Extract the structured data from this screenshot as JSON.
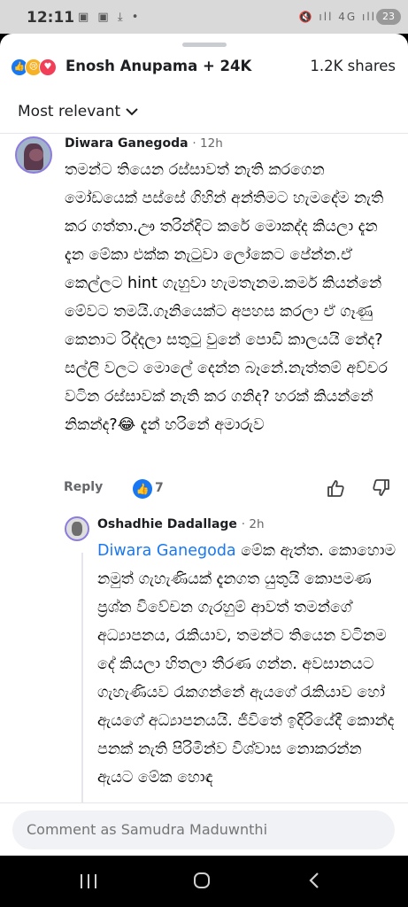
{
  "status_bar": {
    "time": "12:11",
    "left_icons": "▣ ▣ ⤓ •",
    "right_icons": "🔇 ıll 4G ıll",
    "battery": "23"
  },
  "reactions": {
    "names": "Enosh Anupama + 24K",
    "shares": "1.2K shares",
    "icons": [
      "like-icon",
      "sad-icon",
      "love-icon"
    ]
  },
  "sort": {
    "label": "Most relevant"
  },
  "comments": [
    {
      "author": "Diwara Ganegoda",
      "time": "12h",
      "text": "තමන්ට තියෙන රස්සාවත් නැති කරගෙන මෝඩයෙක් පස්සේ ගිහින් අන්තිමට හැමදේම නැති කර ගත්තා.ඌ තරින්දිට කරේ මොකද්ද කියලා දැන දැන මේකා එක්ක නැටුවා ලෝකෙට පේන්න.ඒ කෙල්ලට hint ගැහුවා හැමතැනම.කර්ම කියන්නේ මේවට තමයි.ගෑනියෙක්ට අපහස කරලා ඒ ගෑණු කෙනාට රිද්දලා සතුටු වුනේ පොඩි කාලයයි නේද? සල්ලි වලට මොලේ දෙන්න බෑනේ.නැත්තම් අච්චර වටින රස්සාවක් නැති කර ගනිද? හරක් කියන්නේ නිකන්ද?😂 දැන් හරිනේ අමාරුව",
      "reply_label": "Reply",
      "like_count": "7"
    }
  ],
  "reply": {
    "author": "Oshadhie Dadallage",
    "time": "2h",
    "mention": "Diwara Ganegoda",
    "text": " මේක ඇත්ත. කොහොම නමුත් ගැහැණියක් දැනගත යුතුයි කොපමණ ප්‍රශ්න විවේචන ගැරහුම් ආවත් තමන්ගේ අධ්‍යාපනය, රැකියාව, තමන්ට තියෙන වටිනම දේ කියලා හිතලා තීරණ ගන්න. අවසානයට ගැහැණියව රැකගන්නේ ඇයගේ රැකියාව හෝ ඇයගේ අධ්‍යාපනයයි. ජීවිතේ ඉදිරියේදී කොන්ද පනක් නැති පිරිමින්ව විශ්වාස නොකරන්න ඇයට මේක හොඳ"
  },
  "composer": {
    "placeholder": "Comment as Samudra Maduwnthi"
  }
}
